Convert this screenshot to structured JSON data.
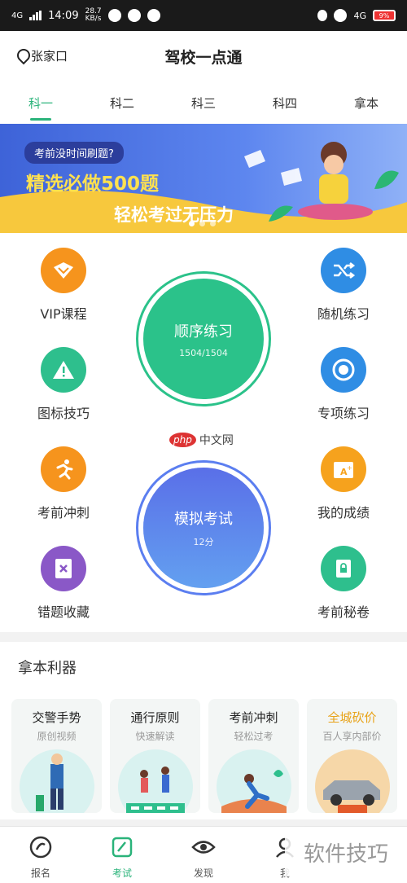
{
  "status_bar": {
    "network": "4G",
    "time": "14:09",
    "speed_top": "28.7",
    "speed_bottom": "KB/s",
    "right_network": "4G",
    "battery": "9%"
  },
  "header": {
    "location": "张家口",
    "title": "驾校一点通"
  },
  "tabs": [
    "科一",
    "科二",
    "科三",
    "科四",
    "拿本"
  ],
  "active_tab_index": 0,
  "banner": {
    "question": "考前没时间刷题?",
    "headline": "精选必做500题",
    "subline": "轻松考过无压力"
  },
  "functions": {
    "vip": "VIP课程",
    "random": "随机练习",
    "icon_skill": "图标技巧",
    "topic": "专项练习",
    "sprint": "考前冲刺",
    "score": "我的成绩",
    "wrong": "错题收藏",
    "secret": "考前秘卷"
  },
  "practice": {
    "label": "顺序练习",
    "progress": "1504/1504"
  },
  "exam": {
    "label": "模拟考试",
    "score": "12分"
  },
  "watermark_center": {
    "badge": "php",
    "text": "中文网"
  },
  "tools": {
    "title": "拿本利器",
    "cards": [
      {
        "title": "交警手势",
        "subtitle": "原创视频"
      },
      {
        "title": "通行原则",
        "subtitle": "快速解读"
      },
      {
        "title": "考前冲刺",
        "subtitle": "轻松过考"
      },
      {
        "title": "全城砍价",
        "subtitle": "百人享内部价"
      }
    ]
  },
  "nav": [
    "报名",
    "考试",
    "发现",
    "我"
  ],
  "active_nav_index": 1,
  "watermark_bottom": "软件技巧",
  "colors": {
    "accent": "#2ab37a",
    "tab_active": "#2ab37a",
    "practice_ring": "#2bc28a",
    "exam_ring": "#5b7ef0"
  }
}
